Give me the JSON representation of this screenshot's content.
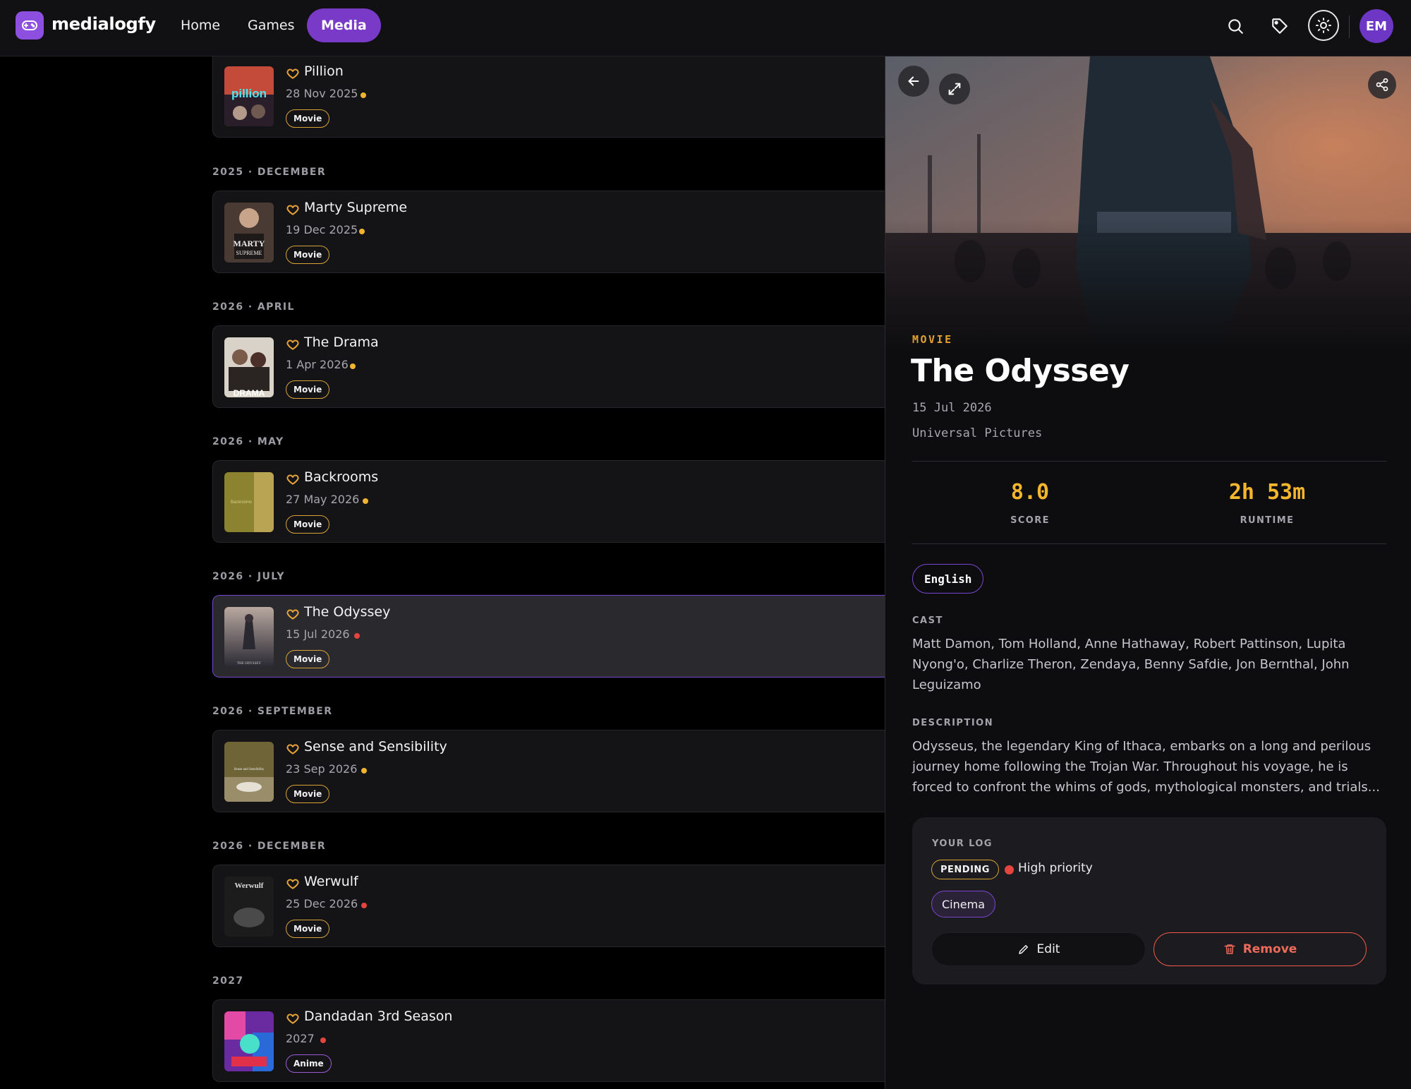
{
  "app": {
    "name": "medialogfy",
    "nav": [
      {
        "label": "Home"
      },
      {
        "label": "Games"
      },
      {
        "label": "Media",
        "active": true
      }
    ],
    "avatar_initials": "EM",
    "icons": [
      "gamepad-icon",
      "search-icon",
      "tag-icon",
      "sun-icon"
    ]
  },
  "list": {
    "groups": [
      {
        "label": "",
        "items": [
          {
            "title": "Pillion",
            "date": "28 Nov 2025",
            "type": "Movie",
            "priority_color": "#f0b52f"
          }
        ]
      },
      {
        "label": "2025 · DECEMBER",
        "items": [
          {
            "title": "Marty Supreme",
            "date": "19 Dec 2025",
            "type": "Movie",
            "priority_color": "#f0b52f"
          }
        ]
      },
      {
        "label": "2026 · APRIL",
        "items": [
          {
            "title": "The Drama",
            "date": "1 Apr 2026",
            "type": "Movie",
            "priority_color": "#f0b52f"
          }
        ]
      },
      {
        "label": "2026 · MAY",
        "items": [
          {
            "title": "Backrooms",
            "date": "27 May 2026",
            "type": "Movie",
            "priority_color": "#f0b52f"
          }
        ]
      },
      {
        "label": "2026 · JULY",
        "items": [
          {
            "title": "The Odyssey",
            "date": "15 Jul 2026",
            "type": "Movie",
            "priority_color": "#e5453f",
            "selected": true
          }
        ]
      },
      {
        "label": "2026 · SEPTEMBER",
        "items": [
          {
            "title": "Sense and Sensibility",
            "date": "23 Sep 2026",
            "type": "Movie",
            "priority_color": "#f0b52f"
          }
        ]
      },
      {
        "label": "2026 · DECEMBER",
        "items": [
          {
            "title": "Werwulf",
            "date": "25 Dec 2026",
            "type": "Movie",
            "priority_color": "#e5453f"
          }
        ]
      },
      {
        "label": "2027",
        "items": [
          {
            "title": "Dandadan 3rd Season",
            "date": "2027",
            "type": "Anime",
            "priority_color": "#e5453f"
          }
        ]
      }
    ]
  },
  "detail": {
    "kind": "MOVIE",
    "title": "The Odyssey",
    "release_date": "15 Jul 2026",
    "studio": "Universal Pictures",
    "score_value": "8.0",
    "score_label": "SCORE",
    "runtime_value": "2h 53m",
    "runtime_label": "RUNTIME",
    "language": "English",
    "cast_label": "CAST",
    "cast": "Matt Damon, Tom Holland, Anne Hathaway, Robert Pattinson, Lupita Nyong'o, Charlize Theron, Zendaya, Benny Safdie, Jon Bernthal, John Leguizamo",
    "description_label": "DESCRIPTION",
    "description": "Odysseus, the legendary King of Ithaca, embarks on a long and perilous journey home following the Trojan War. Throughout his voyage, he is forced to confront the whims of gods, mythological monsters, and trials...",
    "log": {
      "label": "YOUR LOG",
      "status": "PENDING",
      "priority": "High priority",
      "tag": "Cinema",
      "edit_label": "Edit",
      "remove_label": "Remove"
    }
  },
  "colors": {
    "accent": "#7a3ac8",
    "gold": "#f3b62d",
    "danger": "#ef5a4a"
  }
}
